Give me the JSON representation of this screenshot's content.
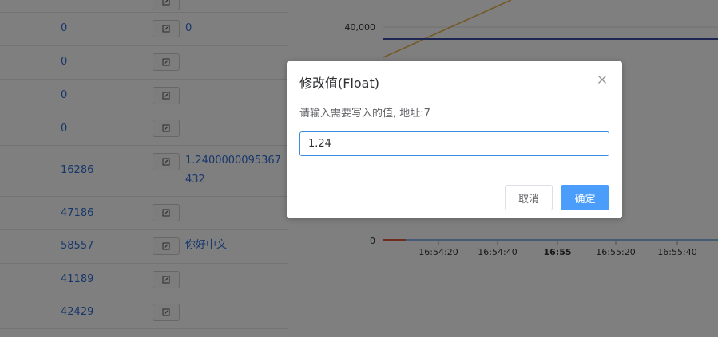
{
  "table": {
    "rows": [
      {
        "value": "",
        "extra": ""
      },
      {
        "value": "0",
        "extra": "0"
      },
      {
        "value": "0",
        "extra": ""
      },
      {
        "value": "0",
        "extra": ""
      },
      {
        "value": "0",
        "extra": ""
      },
      {
        "value": "16286",
        "extra": "1.2400000095367432"
      },
      {
        "value": "47186",
        "extra": ""
      },
      {
        "value": "58557",
        "extra": "你好中文"
      },
      {
        "value": "41189",
        "extra": ""
      },
      {
        "value": "42429",
        "extra": ""
      }
    ]
  },
  "chart_data": {
    "type": "line",
    "y_ticks": [
      "40,000",
      "0"
    ],
    "x_ticks": [
      "16:54:20",
      "16:54:40",
      "16:55",
      "16:55:20",
      "16:55:40"
    ],
    "series": [
      {
        "color": "#e6b34a"
      },
      {
        "color": "#3c4fa8"
      },
      {
        "color": "#e05a3a"
      },
      {
        "color": "#8ab4e8"
      }
    ]
  },
  "dialog": {
    "title": "修改值(Float)",
    "message": "请输入需要写入的值, 地址:7",
    "input_value": "1.24",
    "cancel_label": "取消",
    "ok_label": "确定"
  },
  "colors": {
    "accent": "#4a9dfb",
    "link": "#2f6ed8"
  }
}
